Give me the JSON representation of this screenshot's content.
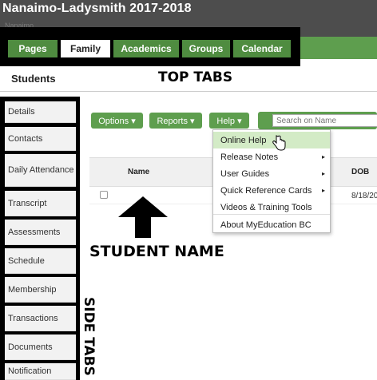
{
  "header": {
    "title": "Nanaimo-Ladysmith 2017-2018",
    "subtitle": "Nanaimo"
  },
  "tabs": [
    {
      "label": "Pages"
    },
    {
      "label": "Family"
    },
    {
      "label": "Academics"
    },
    {
      "label": "Groups"
    },
    {
      "label": "Calendar"
    }
  ],
  "breadcrumb": "Students",
  "annotations": {
    "top_tabs": "TOP TABS",
    "student_name": "STUDENT NAME",
    "side_tabs": "SIDE TABS"
  },
  "side_tabs": [
    "Details",
    "Contacts",
    "Daily Attendance",
    "Transcript",
    "Assessments",
    "Schedule",
    "Membership",
    "Transactions",
    "Documents",
    "Notification"
  ],
  "toolbar": {
    "options": "Options ▾",
    "reports": "Reports ▾",
    "help": "Help ▾",
    "search_placeholder": "Search on Name"
  },
  "table": {
    "headers": {
      "name": "Name",
      "dob": "DOB"
    },
    "rows": [
      {
        "dob": "8/18/20"
      }
    ]
  },
  "help_menu": [
    "Online Help",
    "Release Notes",
    "User Guides",
    "Quick Reference Cards",
    "Videos & Training Tools",
    "About MyEducation BC"
  ],
  "colors": {
    "accent": "#5e9e4e",
    "header": "#4d4d4d"
  }
}
